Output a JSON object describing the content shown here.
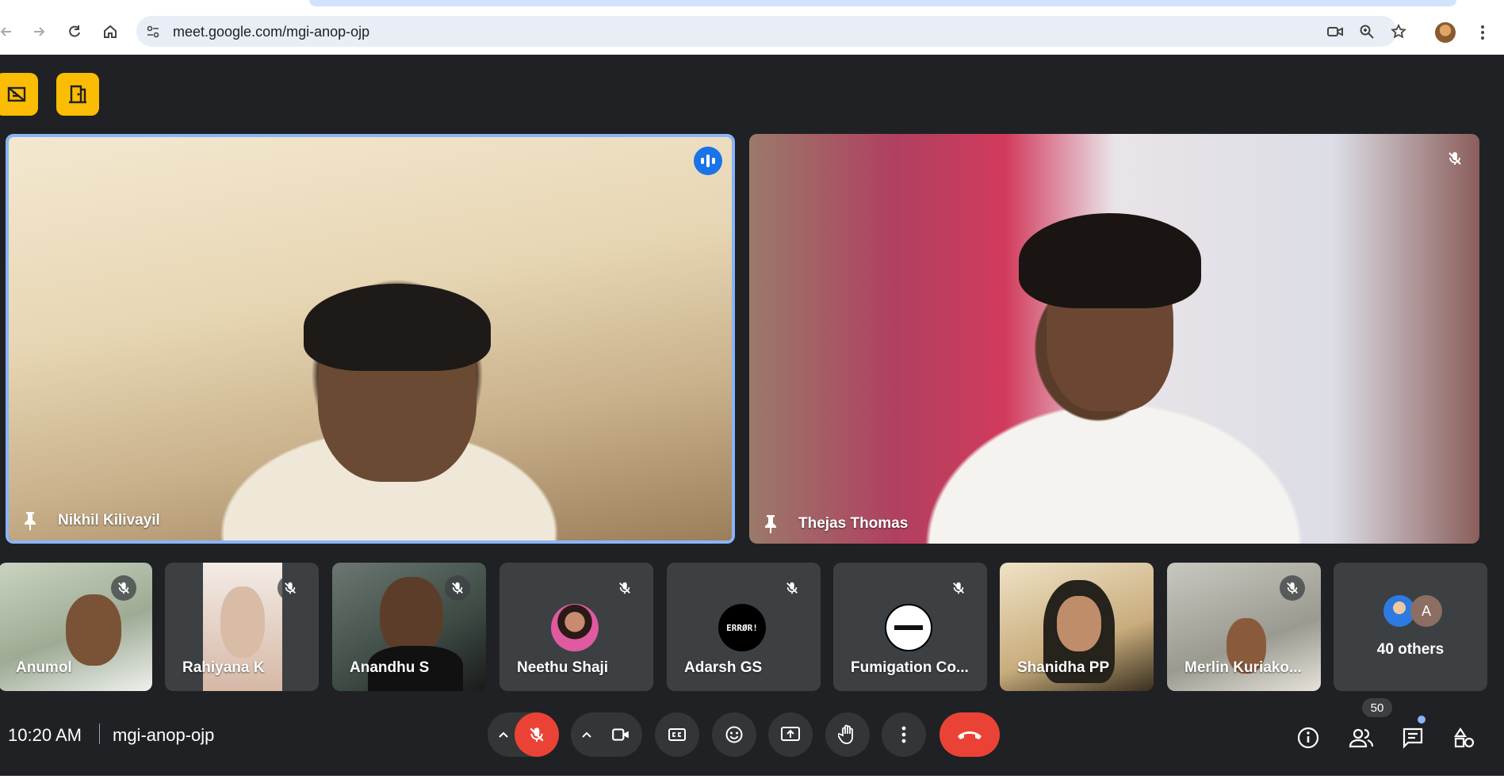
{
  "browser": {
    "url": "meet.google.com/mgi-anop-ojp"
  },
  "main_tiles": [
    {
      "name": "Nikhil Kilivayil",
      "speaking": true
    },
    {
      "name": "Thejas Thomas",
      "muted": true
    }
  ],
  "filmstrip": [
    {
      "name": "Anumol",
      "muted": true
    },
    {
      "name": "Rahiyana K",
      "muted": true
    },
    {
      "name": "Anandhu S",
      "muted": true
    },
    {
      "name": "Neethu Shaji",
      "muted": true
    },
    {
      "name": "Adarsh GS",
      "muted": true,
      "avatar_text": "ERRØR!"
    },
    {
      "name": "Fumigation Co...",
      "muted": true
    },
    {
      "name": "Shanidha PP",
      "muted": false
    },
    {
      "name": "Merlin Kuriako...",
      "muted": true
    }
  ],
  "others": {
    "label": "40 others",
    "avatar_letter": "A"
  },
  "bottom_bar": {
    "time": "10:20 AM",
    "meeting_code": "mgi-anop-ojp",
    "participant_count": "50"
  },
  "colors": {
    "meet_bg": "#202124",
    "tile_bg": "#3c4043",
    "end_call_red": "#ea4335",
    "active_speaker_border": "#8ab4f8",
    "host_controls_yellow": "#fbbc04"
  }
}
